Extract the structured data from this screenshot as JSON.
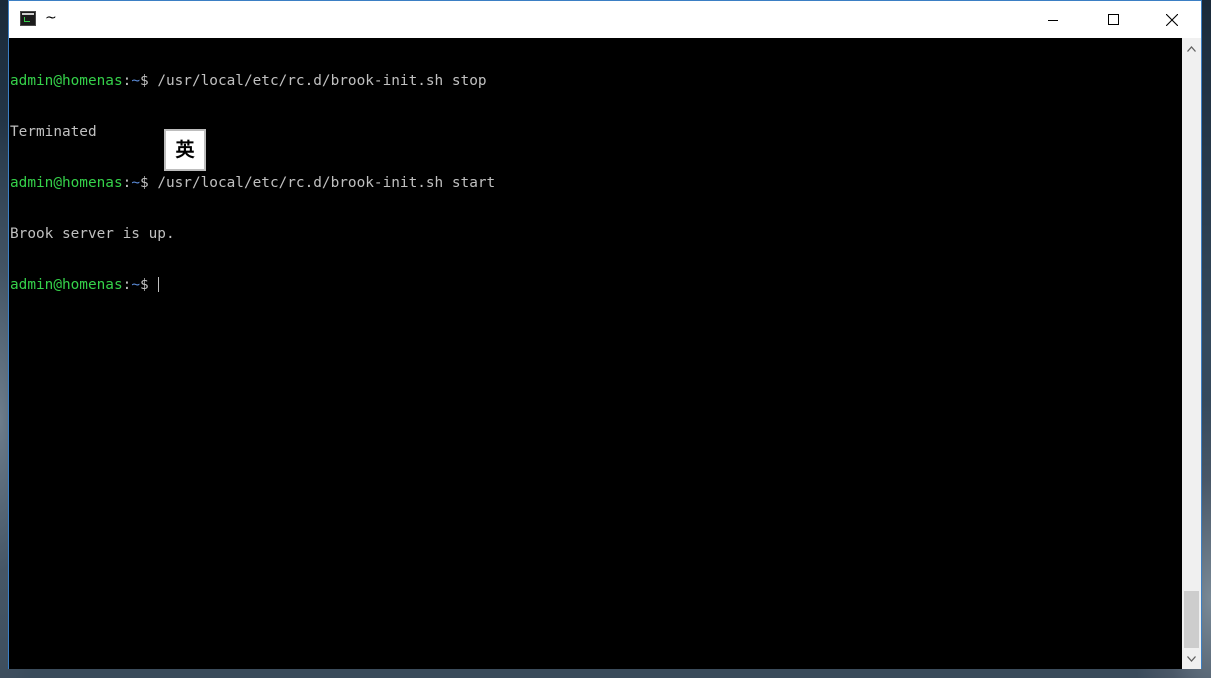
{
  "window": {
    "title": "~",
    "controls": {
      "minimize_icon": "minimize-icon",
      "maximize_icon": "maximize-icon",
      "close_icon": "close-icon"
    }
  },
  "terminal": {
    "colors": {
      "background": "#000000",
      "text": "#c0c0c0",
      "prompt_user": "#35d14a",
      "prompt_path": "#5b8bd8"
    },
    "lines": [
      {
        "user": "admin@homenas",
        "sep": ":",
        "path": "~",
        "symbol": "$ ",
        "command": "/usr/local/etc/rc.d/brook-init.sh stop"
      },
      {
        "output": "Terminated"
      },
      {
        "user": "admin@homenas",
        "sep": ":",
        "path": "~",
        "symbol": "$ ",
        "command": "/usr/local/etc/rc.d/brook-init.sh start"
      },
      {
        "output": "Brook server is up."
      },
      {
        "user": "admin@homenas",
        "sep": ":",
        "path": "~",
        "symbol": "$ ",
        "command": ""
      }
    ]
  },
  "ime": {
    "mode_label": "英"
  },
  "scrollbar": {
    "up_icon": "scroll-up-icon",
    "down_icon": "scroll-down-icon"
  }
}
